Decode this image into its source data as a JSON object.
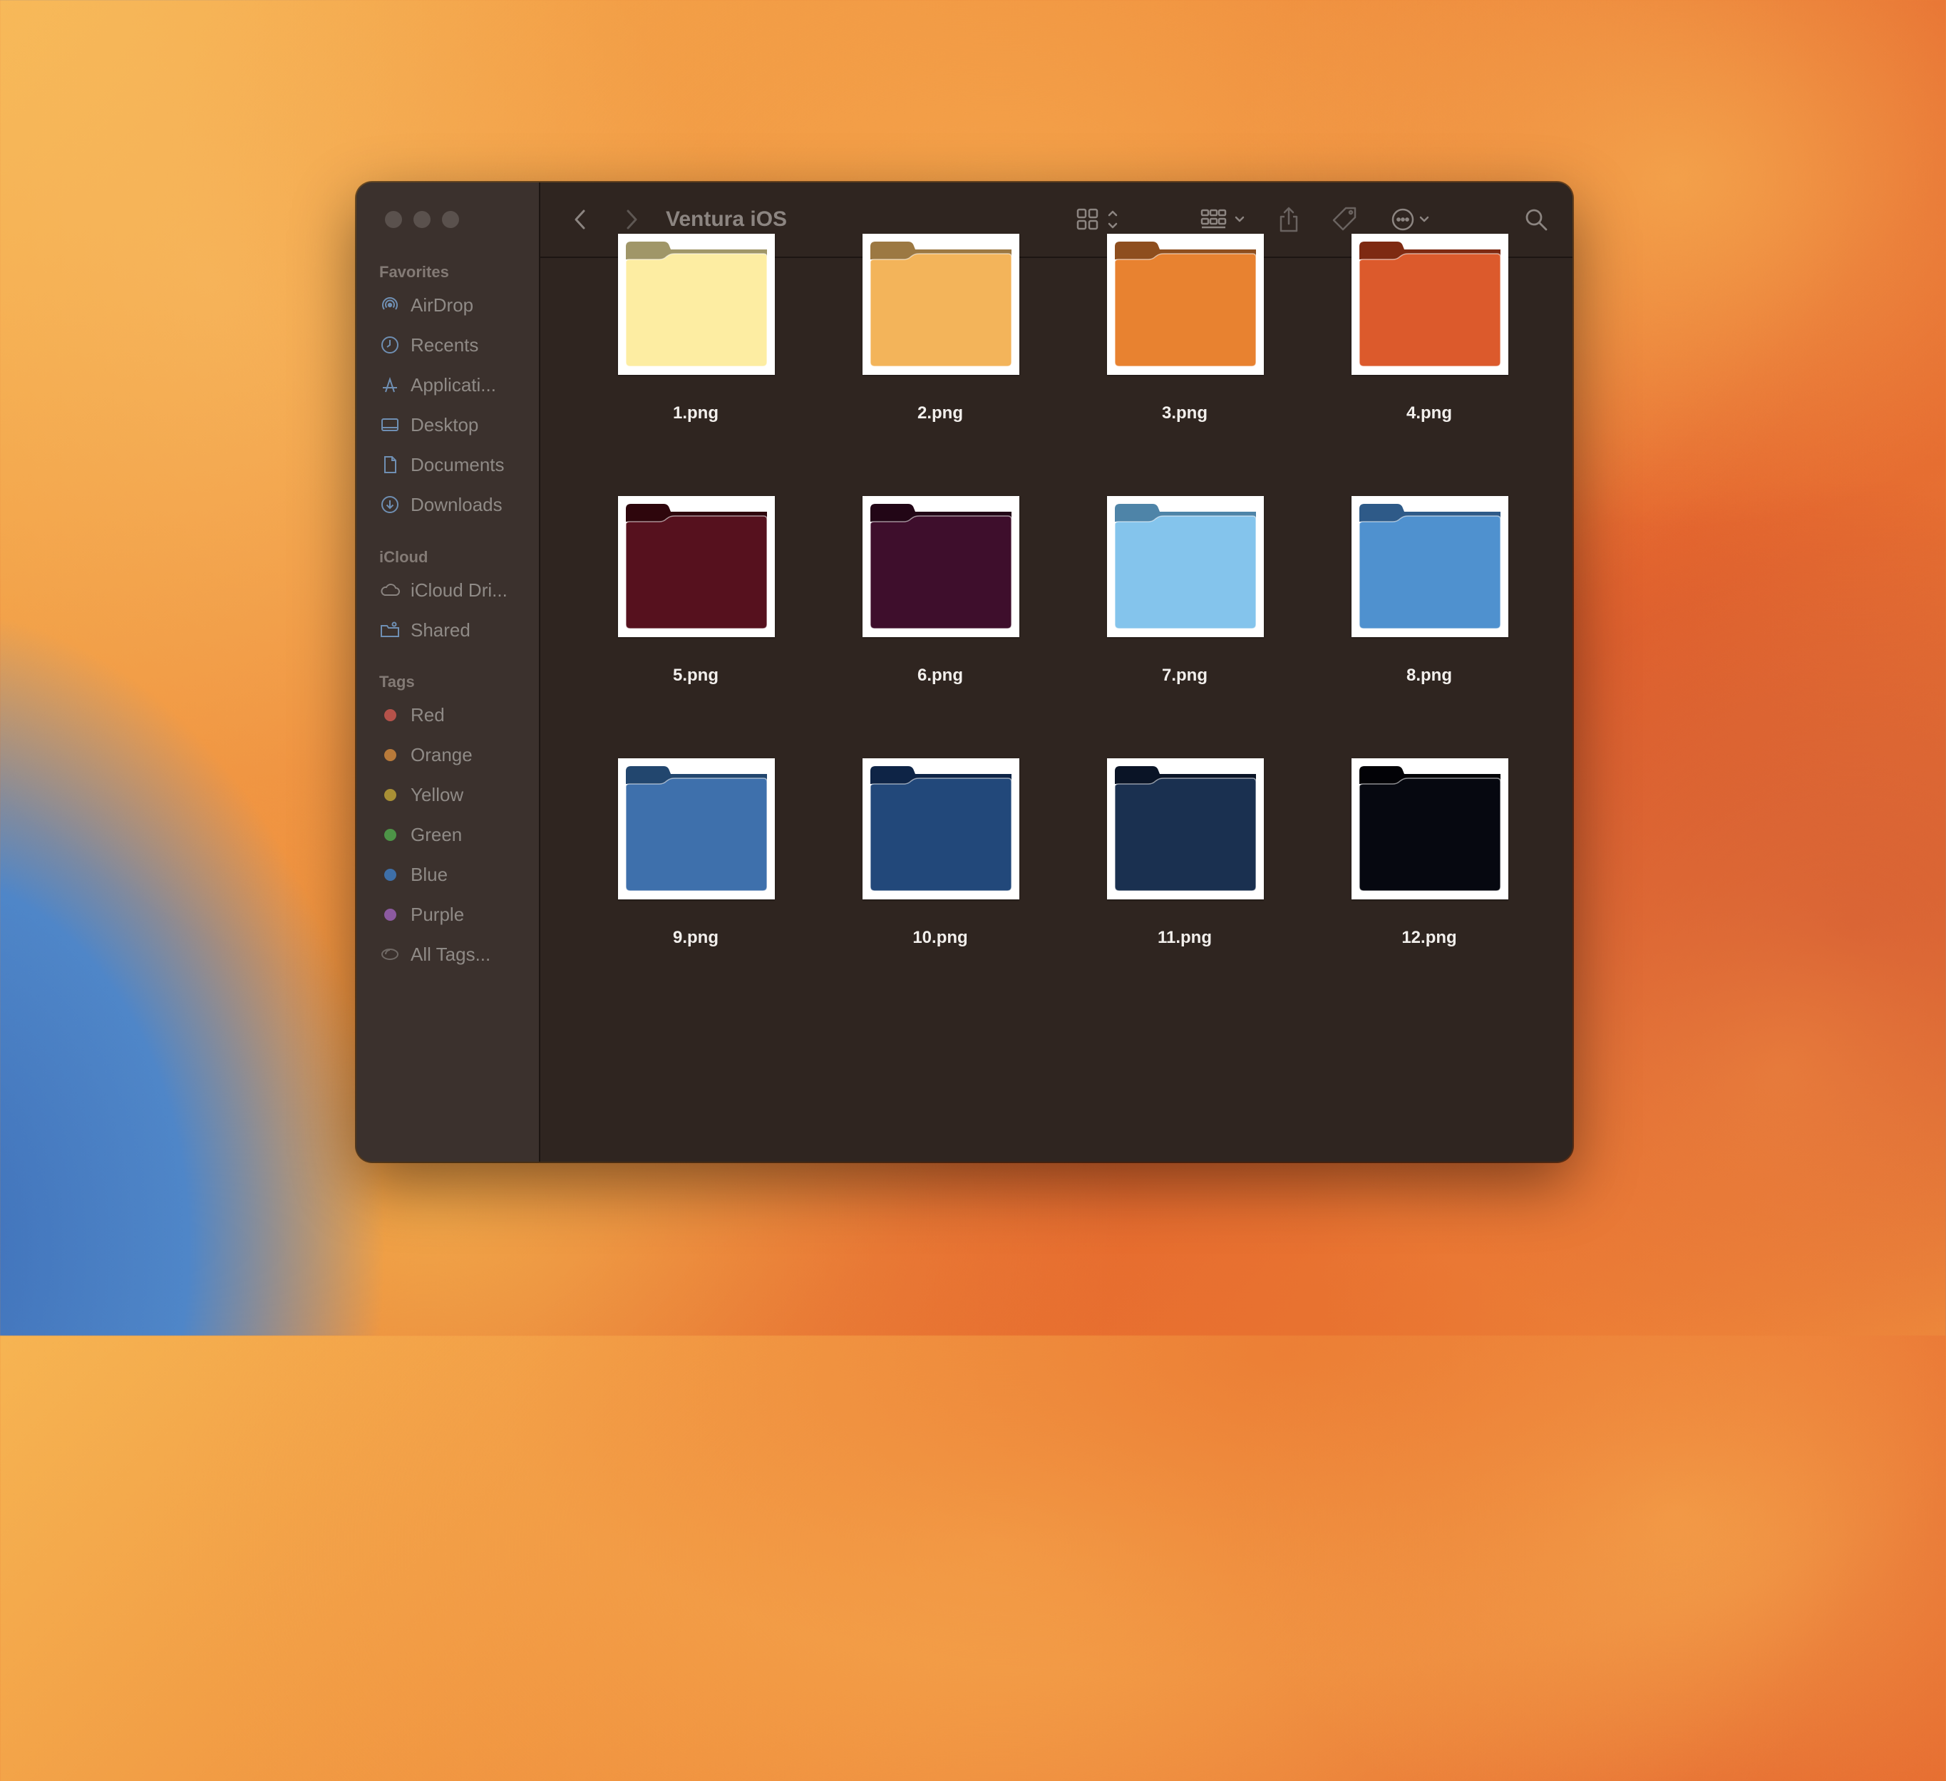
{
  "window": {
    "title": "Ventura iOS"
  },
  "sidebar": {
    "favorites_title": "Favorites",
    "favorites": [
      {
        "label": "AirDrop",
        "icon": "airdrop-icon"
      },
      {
        "label": "Recents",
        "icon": "clock-icon"
      },
      {
        "label": "Applicati...",
        "icon": "applications-icon"
      },
      {
        "label": "Desktop",
        "icon": "desktop-icon"
      },
      {
        "label": "Documents",
        "icon": "document-icon"
      },
      {
        "label": "Downloads",
        "icon": "download-icon"
      }
    ],
    "icloud_title": "iCloud",
    "icloud": [
      {
        "label": "iCloud Dri...",
        "icon": "cloud-icon"
      },
      {
        "label": "Shared",
        "icon": "shared-folder-icon"
      }
    ],
    "tags_title": "Tags",
    "tags": [
      {
        "label": "Red",
        "color": "#b5524a"
      },
      {
        "label": "Orange",
        "color": "#b87a3a"
      },
      {
        "label": "Yellow",
        "color": "#a88f35"
      },
      {
        "label": "Green",
        "color": "#4d9447"
      },
      {
        "label": "Blue",
        "color": "#3e6fa8"
      },
      {
        "label": "Purple",
        "color": "#8c5aa0"
      },
      {
        "label": "All Tags...",
        "color": ""
      }
    ]
  },
  "files": [
    {
      "name": "1.png",
      "color": "#fdeda2",
      "tab": "#a09668"
    },
    {
      "name": "2.png",
      "color": "#f3b45a",
      "tab": "#9c7842"
    },
    {
      "name": "3.png",
      "color": "#e88230",
      "tab": "#8e4e1e"
    },
    {
      "name": "4.png",
      "color": "#dc5a2c",
      "tab": "#7e2a12"
    },
    {
      "name": "5.png",
      "color": "#56111e",
      "tab": "#2e060c"
    },
    {
      "name": "6.png",
      "color": "#3e0e2c",
      "tab": "#220616"
    },
    {
      "name": "7.png",
      "color": "#84c4ec",
      "tab": "#4e84a8"
    },
    {
      "name": "8.png",
      "color": "#4f91cf",
      "tab": "#2e5a88"
    },
    {
      "name": "9.png",
      "color": "#3e70ac",
      "tab": "#22466e"
    },
    {
      "name": "10.png",
      "color": "#22487a",
      "tab": "#0e2446"
    },
    {
      "name": "11.png",
      "color": "#1a3050",
      "tab": "#0a1426"
    },
    {
      "name": "12.png",
      "color": "#060810",
      "tab": "#020206"
    }
  ]
}
